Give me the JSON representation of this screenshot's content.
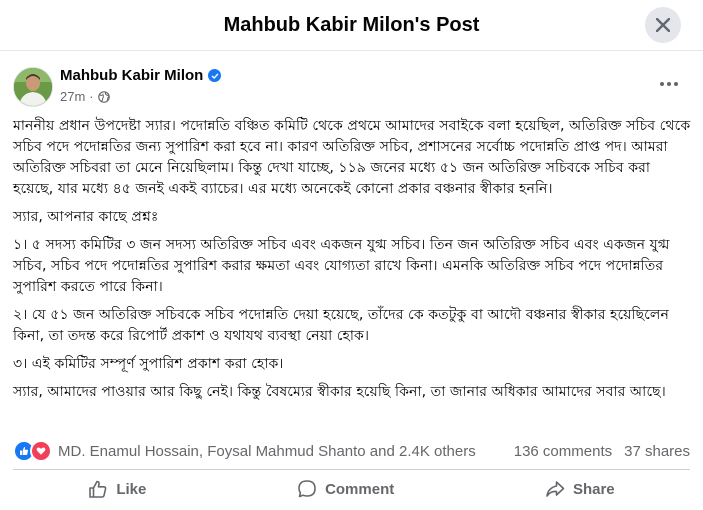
{
  "header": {
    "title": "Mahbub Kabir Milon's Post"
  },
  "post": {
    "author": "Mahbub Kabir Milon",
    "time": "27m",
    "paragraphs": [
      "মাননীয় প্রধান উপদেষ্টা স্যার। পদোন্নতি বঞ্চিত কমিটি থেকে প্রথমে আমাদের সবাইকে বলা হয়েছিল, অতিরিক্ত সচিব থেকে সচিব পদে পদোন্নতির জন্য সুপারিশ করা হবে না। কারণ অতিরিক্ত সচিব, প্রশাসনের সর্বোচ্চ পদোন্নতি প্রাপ্ত পদ। আমরা অতিরিক্ত সচিবরা তা মেনে নিয়েছিলাম। কিন্তু দেখা যাচ্ছে, ১১৯ জনের মধ্যে ৫১ জন অতিরিক্ত সচিবকে সচিব করা হয়েছে, যার মধ্যে ৪৫ জনই একই ব্যাচের। এর মধ্যে অনেকেই কোনো প্রকার বঞ্চনার স্বীকার হননি।",
      "স্যার, আপনার কাছে প্রশ্নঃ",
      "১। ৫ সদস্য কমিটির ৩ জন সদস্য অতিরিক্ত সচিব এবং একজন যুগ্ম সচিব। তিন জন অতিরিক্ত সচিব এবং একজন যুগ্ম সচিব, সচিব পদে পদোন্নতির সুপারিশ করার ক্ষমতা এবং যোগ্যতা রাখে কিনা। এমনকি অতিরিক্ত সচিব পদে পদোন্নতির সুপারিশ করতে পারে কিনা।",
      "২। যে ৫১ জন অতিরিক্ত সচিবকে সচিব পদোন্নতি দেয়া হয়েছে, তাঁদের কে কতটুকু বা আদৌ বঞ্চনার স্বীকার হয়েছিলেন কিনা, তা তদন্ত করে রিপোর্ট প্রকাশ ও যথাযথ ব্যবস্থা নেয়া হোক।",
      "৩। এই কমিটির সম্পূর্ণ সুপারিশ প্রকাশ করা হোক।",
      "স্যার, আমাদের পাওয়ার আর কিছু নেই। কিন্তু বৈষম্যের স্বীকার হয়েছি কিনা, তা জানার অধিকার আমাদের সবার আছে।"
    ]
  },
  "reactions": {
    "reactors": "MD. Enamul Hossain, Foysal Mahmud Shanto and 2.4K others",
    "comments": "136 comments",
    "shares": "37 shares"
  },
  "actions": {
    "like": "Like",
    "comment": "Comment",
    "share": "Share"
  },
  "colors": {
    "accent": "#1877f2",
    "love": "#f33e58",
    "muted": "#65676b"
  }
}
